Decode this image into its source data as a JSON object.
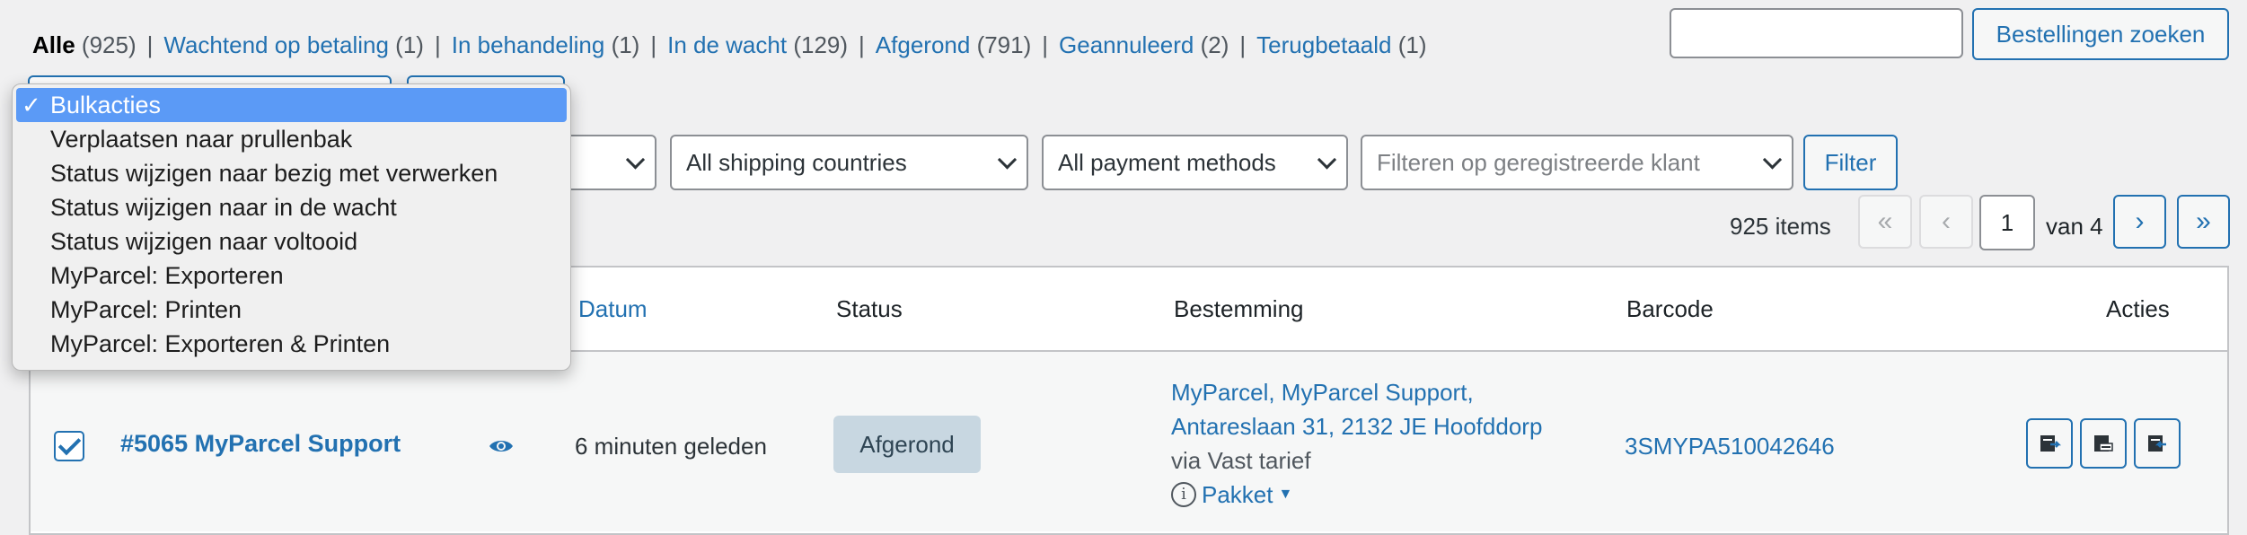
{
  "status_filters": [
    {
      "label": "Alle",
      "count": "(925)",
      "current": true
    },
    {
      "label": "Wachtend op betaling",
      "count": "(1)"
    },
    {
      "label": "In behandeling",
      "count": "(1)"
    },
    {
      "label": "In de wacht",
      "count": "(129)"
    },
    {
      "label": "Afgerond",
      "count": "(791)"
    },
    {
      "label": "Geannuleerd",
      "count": "(2)"
    },
    {
      "label": "Terugbetaald",
      "count": "(1)"
    }
  ],
  "separator": "|",
  "search": {
    "value": "",
    "button_label": "Bestellingen zoeken"
  },
  "filters": {
    "date_value": "",
    "shipping_country": "All shipping countries",
    "payment_method": "All payment methods",
    "customer_placeholder": "Filteren op geregistreerde klant",
    "filter_button": "Filter"
  },
  "pagination": {
    "items_count": "925 items",
    "first": "«",
    "prev": "‹",
    "current_page": "1",
    "of_label": "van 4",
    "next": "›",
    "last": "»"
  },
  "table": {
    "headers": {
      "datum": "Datum",
      "status": "Status",
      "bestemming": "Bestemming",
      "barcode": "Barcode",
      "acties": "Acties"
    },
    "rows": [
      {
        "order": "#5065 MyParcel Support",
        "date": "6 minuten geleden",
        "status": "Afgerond",
        "destination_line1": "MyParcel, MyParcel Support,",
        "destination_line2": "Antareslaan 31, 2132 JE Hoofddorp",
        "shipping_method": "via Vast tarief",
        "package_type": "Pakket",
        "barcode": "3SMYPA510042646"
      }
    ]
  },
  "bulk_actions": {
    "selected_check": "✓",
    "options": [
      "Bulkacties",
      "Verplaatsen naar prullenbak",
      "Status wijzigen naar bezig met verwerken",
      "Status wijzigen naar in de wacht",
      "Status wijzigen naar voltooid",
      "MyParcel: Exporteren",
      "MyParcel: Printen",
      "MyParcel: Exporteren & Printen"
    ]
  },
  "colors": {
    "accent": "#2271b1",
    "selected_option": "#5b9af6",
    "status_completed_bg": "#c8d7e1"
  }
}
